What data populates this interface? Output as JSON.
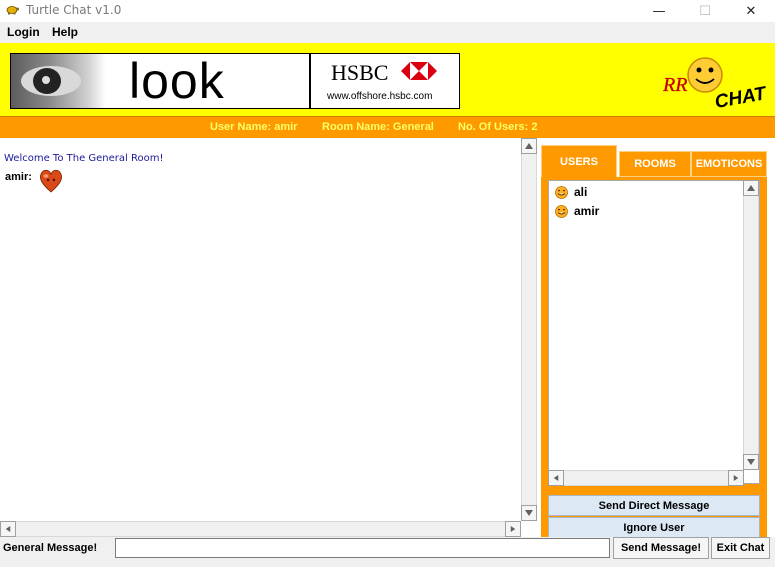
{
  "window": {
    "title": "Turtle Chat v1.0",
    "minimize_glyph": "—",
    "maximize_glyph": "☐",
    "close_glyph": "✕"
  },
  "menu": {
    "items": [
      {
        "label": "Login"
      },
      {
        "label": "Help"
      }
    ]
  },
  "banner": {
    "ad_word": "look",
    "ad_brand": "HSBC",
    "ad_url": "www.offshore.hsbc.com",
    "logo_text": "CHAT",
    "logo_initials": "RR"
  },
  "info": {
    "user_name": "User Name: amir",
    "room_name": "Room Name: General",
    "user_count": "No. Of Users: 2"
  },
  "chat": {
    "welcome": "Welcome To The General Room!",
    "messages": [
      {
        "sender": "amir:",
        "content_icon": "heart-emoticon"
      }
    ]
  },
  "tabs": [
    {
      "label": "USERS",
      "active": true
    },
    {
      "label": "ROOMS",
      "active": false
    },
    {
      "label": "EMOTICONS",
      "active": false
    }
  ],
  "users": [
    {
      "name": "ali",
      "icon": "smiley-icon"
    },
    {
      "name": "amir",
      "icon": "smiley-icon"
    }
  ],
  "panel_buttons": {
    "direct": "Send Direct Message",
    "ignore": "Ignore User"
  },
  "bottom": {
    "label": "General Message!",
    "input_value": "",
    "send": "Send Message!",
    "exit": "Exit Chat"
  },
  "colors": {
    "header_bg": "#ffff00",
    "accent": "#ff9900",
    "info_text": "#ffff66",
    "welcome_text": "#1a1a9a"
  }
}
